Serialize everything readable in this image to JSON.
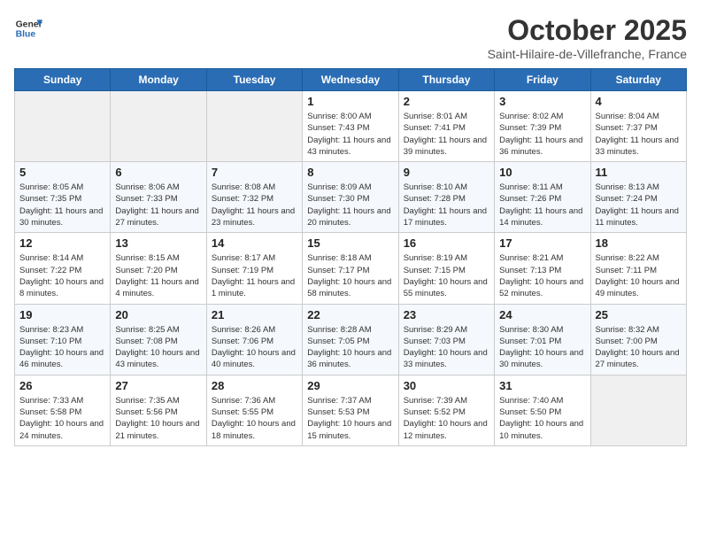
{
  "header": {
    "logo_line1": "General",
    "logo_line2": "Blue",
    "month": "October 2025",
    "location": "Saint-Hilaire-de-Villefranche, France"
  },
  "weekdays": [
    "Sunday",
    "Monday",
    "Tuesday",
    "Wednesday",
    "Thursday",
    "Friday",
    "Saturday"
  ],
  "weeks": [
    [
      {
        "day": "",
        "empty": true
      },
      {
        "day": "",
        "empty": true
      },
      {
        "day": "",
        "empty": true
      },
      {
        "day": "1",
        "sunrise": "8:00 AM",
        "sunset": "7:43 PM",
        "daylight": "11 hours and 43 minutes."
      },
      {
        "day": "2",
        "sunrise": "8:01 AM",
        "sunset": "7:41 PM",
        "daylight": "11 hours and 39 minutes."
      },
      {
        "day": "3",
        "sunrise": "8:02 AM",
        "sunset": "7:39 PM",
        "daylight": "11 hours and 36 minutes."
      },
      {
        "day": "4",
        "sunrise": "8:04 AM",
        "sunset": "7:37 PM",
        "daylight": "11 hours and 33 minutes."
      }
    ],
    [
      {
        "day": "5",
        "sunrise": "8:05 AM",
        "sunset": "7:35 PM",
        "daylight": "11 hours and 30 minutes."
      },
      {
        "day": "6",
        "sunrise": "8:06 AM",
        "sunset": "7:33 PM",
        "daylight": "11 hours and 27 minutes."
      },
      {
        "day": "7",
        "sunrise": "8:08 AM",
        "sunset": "7:32 PM",
        "daylight": "11 hours and 23 minutes."
      },
      {
        "day": "8",
        "sunrise": "8:09 AM",
        "sunset": "7:30 PM",
        "daylight": "11 hours and 20 minutes."
      },
      {
        "day": "9",
        "sunrise": "8:10 AM",
        "sunset": "7:28 PM",
        "daylight": "11 hours and 17 minutes."
      },
      {
        "day": "10",
        "sunrise": "8:11 AM",
        "sunset": "7:26 PM",
        "daylight": "11 hours and 14 minutes."
      },
      {
        "day": "11",
        "sunrise": "8:13 AM",
        "sunset": "7:24 PM",
        "daylight": "11 hours and 11 minutes."
      }
    ],
    [
      {
        "day": "12",
        "sunrise": "8:14 AM",
        "sunset": "7:22 PM",
        "daylight": "10 hours and 8 minutes."
      },
      {
        "day": "13",
        "sunrise": "8:15 AM",
        "sunset": "7:20 PM",
        "daylight": "11 hours and 4 minutes."
      },
      {
        "day": "14",
        "sunrise": "8:17 AM",
        "sunset": "7:19 PM",
        "daylight": "11 hours and 1 minute."
      },
      {
        "day": "15",
        "sunrise": "8:18 AM",
        "sunset": "7:17 PM",
        "daylight": "10 hours and 58 minutes."
      },
      {
        "day": "16",
        "sunrise": "8:19 AM",
        "sunset": "7:15 PM",
        "daylight": "10 hours and 55 minutes."
      },
      {
        "day": "17",
        "sunrise": "8:21 AM",
        "sunset": "7:13 PM",
        "daylight": "10 hours and 52 minutes."
      },
      {
        "day": "18",
        "sunrise": "8:22 AM",
        "sunset": "7:11 PM",
        "daylight": "10 hours and 49 minutes."
      }
    ],
    [
      {
        "day": "19",
        "sunrise": "8:23 AM",
        "sunset": "7:10 PM",
        "daylight": "10 hours and 46 minutes."
      },
      {
        "day": "20",
        "sunrise": "8:25 AM",
        "sunset": "7:08 PM",
        "daylight": "10 hours and 43 minutes."
      },
      {
        "day": "21",
        "sunrise": "8:26 AM",
        "sunset": "7:06 PM",
        "daylight": "10 hours and 40 minutes."
      },
      {
        "day": "22",
        "sunrise": "8:28 AM",
        "sunset": "7:05 PM",
        "daylight": "10 hours and 36 minutes."
      },
      {
        "day": "23",
        "sunrise": "8:29 AM",
        "sunset": "7:03 PM",
        "daylight": "10 hours and 33 minutes."
      },
      {
        "day": "24",
        "sunrise": "8:30 AM",
        "sunset": "7:01 PM",
        "daylight": "10 hours and 30 minutes."
      },
      {
        "day": "25",
        "sunrise": "8:32 AM",
        "sunset": "7:00 PM",
        "daylight": "10 hours and 27 minutes."
      }
    ],
    [
      {
        "day": "26",
        "sunrise": "7:33 AM",
        "sunset": "5:58 PM",
        "daylight": "10 hours and 24 minutes."
      },
      {
        "day": "27",
        "sunrise": "7:35 AM",
        "sunset": "5:56 PM",
        "daylight": "10 hours and 21 minutes."
      },
      {
        "day": "28",
        "sunrise": "7:36 AM",
        "sunset": "5:55 PM",
        "daylight": "10 hours and 18 minutes."
      },
      {
        "day": "29",
        "sunrise": "7:37 AM",
        "sunset": "5:53 PM",
        "daylight": "10 hours and 15 minutes."
      },
      {
        "day": "30",
        "sunrise": "7:39 AM",
        "sunset": "5:52 PM",
        "daylight": "10 hours and 12 minutes."
      },
      {
        "day": "31",
        "sunrise": "7:40 AM",
        "sunset": "5:50 PM",
        "daylight": "10 hours and 10 minutes."
      },
      {
        "day": "",
        "empty": true
      }
    ]
  ]
}
